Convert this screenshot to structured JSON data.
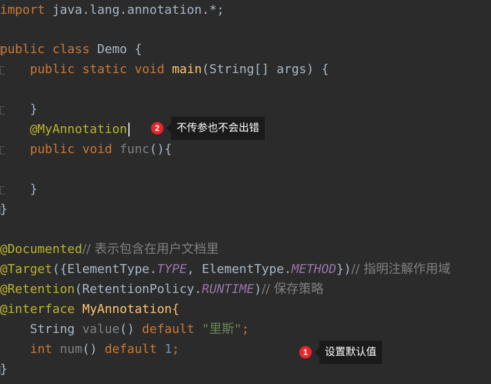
{
  "code": {
    "l1": {
      "kw": "import",
      "rest": " java.lang.annotation.*;"
    },
    "l3": {
      "kw1": "public",
      "kw2": "class",
      "name": " Demo {"
    },
    "l4": {
      "indent": "    ",
      "kw1": "public",
      "kw2": "static",
      "kw3": "void",
      "fn": "main",
      "rest": "(String[] args) {"
    },
    "l6": {
      "text": "    }"
    },
    "l7": {
      "indent": "    ",
      "ann": "@MyAnnotation"
    },
    "l8": {
      "indent": "    ",
      "kw1": "public",
      "kw2": "void",
      "fn": "func",
      "rest": "(){"
    },
    "l10": {
      "text": "    }"
    },
    "l11": {
      "text": "}"
    },
    "l13": {
      "ann": "@Documented",
      "cmt": "// 表示包含在用户文档里"
    },
    "l14": {
      "ann": "@Target",
      "p1": "({ElementType.",
      "c1": "TYPE",
      "p2": ", ElementType.",
      "c2": "METHOD",
      "p3": "})",
      "cmt": "// 指明注解作用域"
    },
    "l15": {
      "ann": "@Retention",
      "p1": "(RetentionPolicy.",
      "c1": "RUNTIME",
      "p2": ")",
      "cmt": "// 保存策略"
    },
    "l16": {
      "ann": "@interface",
      "rest": " MyAnnotation{"
    },
    "l17": {
      "indent": "    ",
      "type": "String ",
      "fn": "value",
      "paren": "() ",
      "kw": "default",
      "str": "\"里斯\"",
      "semi": ";"
    },
    "l18": {
      "indent": "    ",
      "kw1": "int",
      "fn": "num",
      "paren": "() ",
      "kw2": "default",
      "num": "1",
      "semi": ";"
    },
    "l19": {
      "text": "}"
    }
  },
  "callouts": [
    {
      "badge": "2",
      "text": "不传参也不会出错"
    },
    {
      "badge": "1",
      "text": "设置默认值"
    }
  ]
}
